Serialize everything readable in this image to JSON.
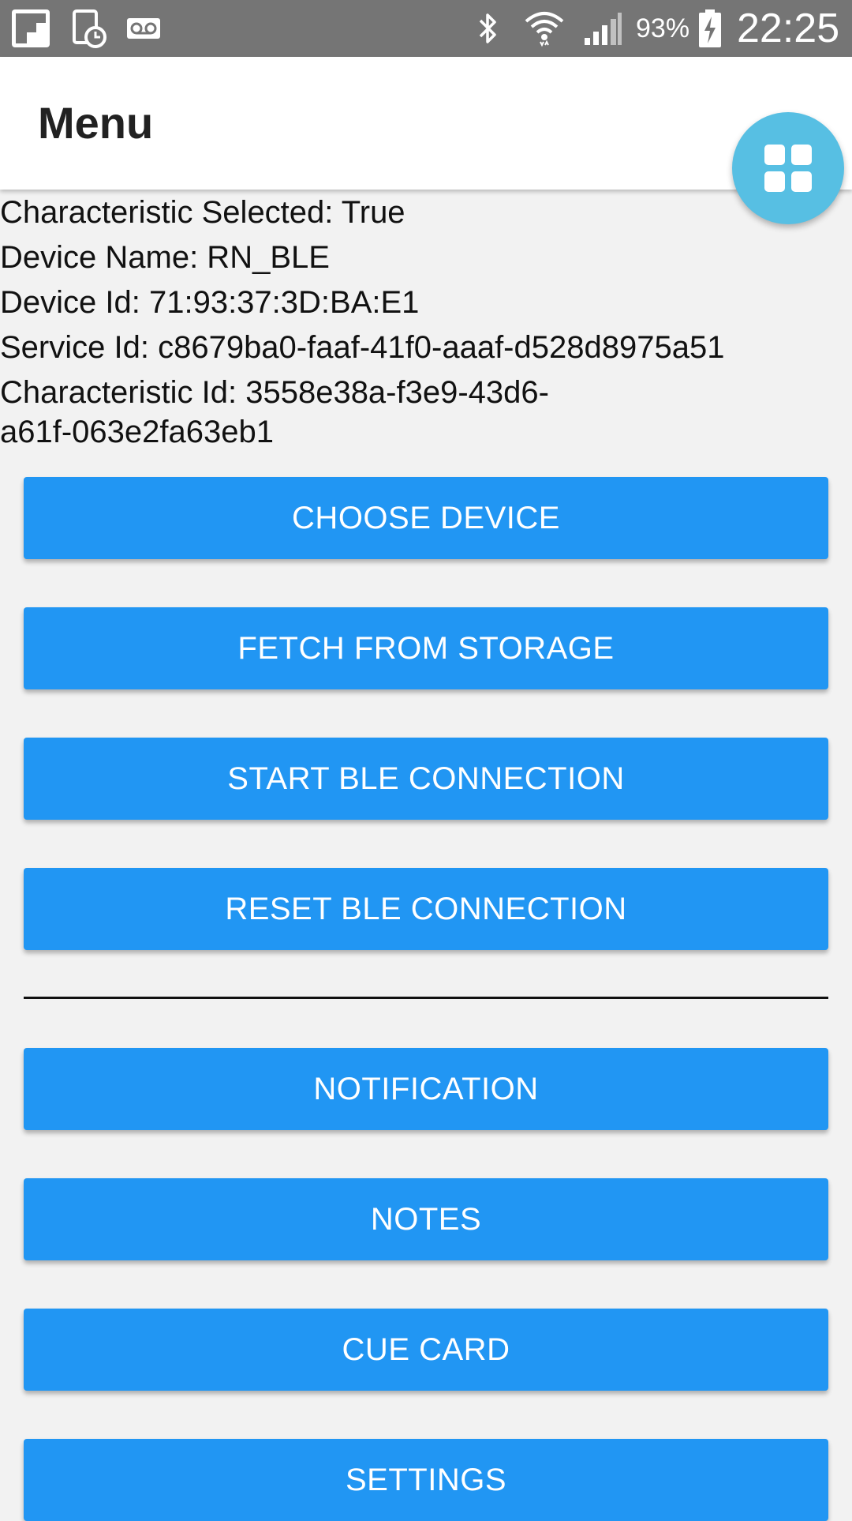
{
  "status_bar": {
    "battery": "93%",
    "time": "22:25",
    "icons": [
      "flipboard-icon",
      "alarm-clock-icon",
      "voicemail-icon",
      "bluetooth-icon",
      "wifi-icon",
      "cellular-signal-icon",
      "battery-charging-icon"
    ]
  },
  "app_bar": {
    "title": "Menu"
  },
  "fab": {
    "icon": "grid-apps-icon",
    "color": "#57bfe3"
  },
  "info": {
    "characteristic_selected": "Characteristic Selected: True",
    "device_name": "Device Name: RN_BLE",
    "device_id": "Device Id: 71:93:37:3D:BA:E1",
    "service_id": "Service Id: c8679ba0-faaf-41f0-aaaf-d528d8975a51",
    "characteristic_id": "Characteristic Id: 3558e38a-f3e9-43d6-a61f-063e2fa63eb1"
  },
  "buttons": {
    "choose_device": "CHOOSE DEVICE",
    "fetch_from_storage": "FETCH FROM STORAGE",
    "start_ble_connection": "START BLE CONNECTION",
    "reset_ble_connection": "RESET BLE CONNECTION",
    "notification": "NOTIFICATION",
    "notes": "NOTES",
    "cue_card": "CUE CARD",
    "settings": "SETTINGS"
  },
  "colors": {
    "button": "#2196f3",
    "status_bar": "#757575",
    "background": "#f2f2f2"
  }
}
